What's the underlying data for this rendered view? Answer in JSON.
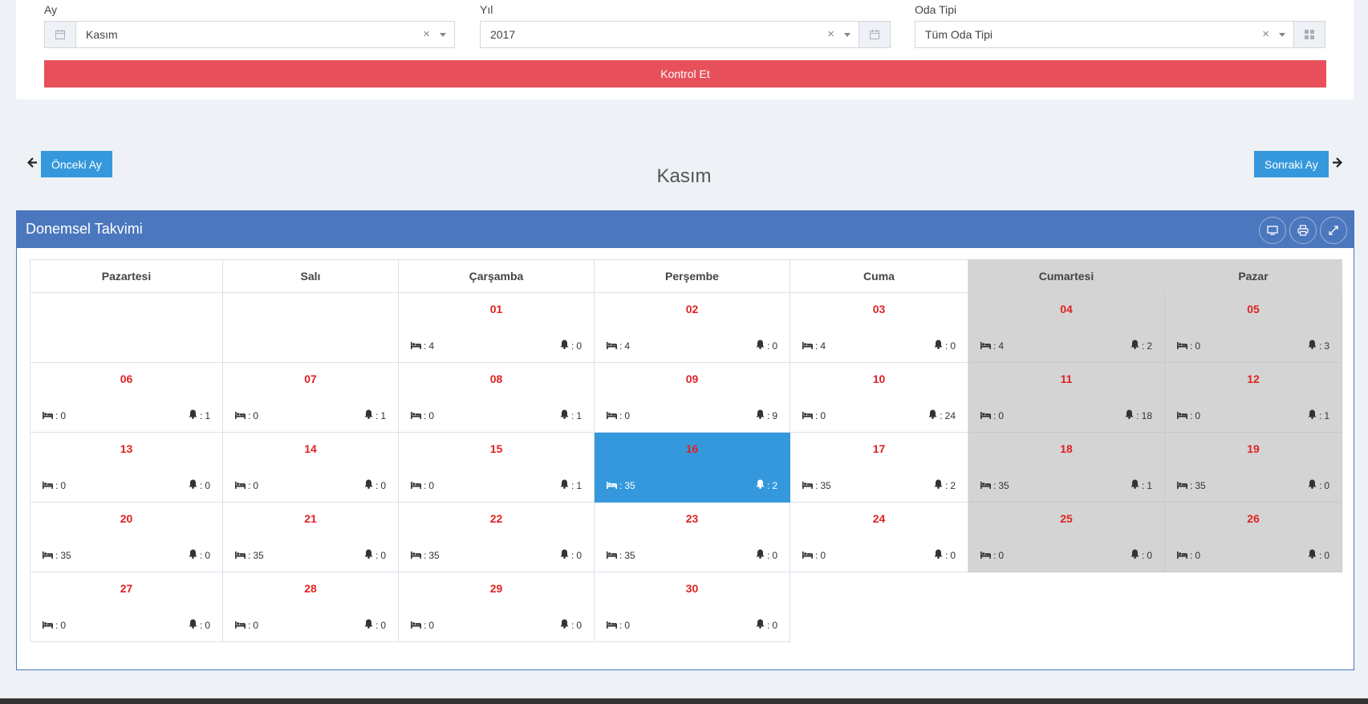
{
  "filters": {
    "month": {
      "label": "Ay",
      "value": "Kasım",
      "clear": "×"
    },
    "year": {
      "label": "Yıl",
      "value": "2017",
      "clear": "×"
    },
    "room_type": {
      "label": "Oda Tipi",
      "value": "Tüm Oda Tipi",
      "clear": "×"
    },
    "submit_label": "Kontrol Et"
  },
  "nav": {
    "prev_label": "Önceki Ay",
    "next_label": "Sonraki Ay",
    "prev_arrow": "🡐",
    "next_arrow": "🡒",
    "month_title": "Kasım"
  },
  "portlet": {
    "title": "Donemsel Takvimi",
    "tools": [
      "monitor-icon",
      "print-icon",
      "fullscreen-icon"
    ]
  },
  "calendar": {
    "weekdays": [
      "Pazartesi",
      "Salı",
      "Çarşamba",
      "Perşembe",
      "Cuma",
      "Cumartesi",
      "Pazar"
    ],
    "weekend_color": "#d4d4d4",
    "today_color": "#3598dc",
    "day_color": "#e02222",
    "stat_prefix": ": ",
    "rows": [
      [
        null,
        null,
        {
          "day": "01",
          "bed": "4",
          "bell": "0"
        },
        {
          "day": "02",
          "bed": "4",
          "bell": "0"
        },
        {
          "day": "03",
          "bed": "4",
          "bell": "0"
        },
        {
          "day": "04",
          "bed": "4",
          "bell": "2"
        },
        {
          "day": "05",
          "bed": "0",
          "bell": "3"
        }
      ],
      [
        {
          "day": "06",
          "bed": "0",
          "bell": "1"
        },
        {
          "day": "07",
          "bed": "0",
          "bell": "1"
        },
        {
          "day": "08",
          "bed": "0",
          "bell": "1"
        },
        {
          "day": "09",
          "bed": "0",
          "bell": "9"
        },
        {
          "day": "10",
          "bed": "0",
          "bell": "24"
        },
        {
          "day": "11",
          "bed": "0",
          "bell": "18"
        },
        {
          "day": "12",
          "bed": "0",
          "bell": "1"
        }
      ],
      [
        {
          "day": "13",
          "bed": "0",
          "bell": "0"
        },
        {
          "day": "14",
          "bed": "0",
          "bell": "0"
        },
        {
          "day": "15",
          "bed": "0",
          "bell": "1"
        },
        {
          "day": "16",
          "bed": "35",
          "bell": "2",
          "today": true
        },
        {
          "day": "17",
          "bed": "35",
          "bell": "2"
        },
        {
          "day": "18",
          "bed": "35",
          "bell": "1"
        },
        {
          "day": "19",
          "bed": "35",
          "bell": "0"
        }
      ],
      [
        {
          "day": "20",
          "bed": "35",
          "bell": "0"
        },
        {
          "day": "21",
          "bed": "35",
          "bell": "0"
        },
        {
          "day": "22",
          "bed": "35",
          "bell": "0"
        },
        {
          "day": "23",
          "bed": "35",
          "bell": "0"
        },
        {
          "day": "24",
          "bed": "0",
          "bell": "0"
        },
        {
          "day": "25",
          "bed": "0",
          "bell": "0"
        },
        {
          "day": "26",
          "bed": "0",
          "bell": "0"
        }
      ],
      [
        {
          "day": "27",
          "bed": "0",
          "bell": "0"
        },
        {
          "day": "28",
          "bed": "0",
          "bell": "0"
        },
        {
          "day": "29",
          "bed": "0",
          "bell": "0"
        },
        {
          "day": "30",
          "bed": "0",
          "bell": "0"
        },
        "end",
        "end",
        "end"
      ]
    ]
  }
}
